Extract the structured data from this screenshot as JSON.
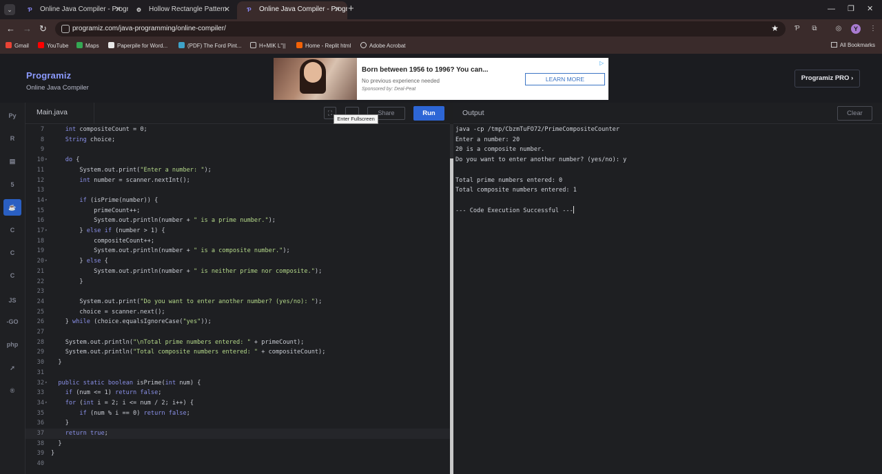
{
  "browser": {
    "tabs": [
      {
        "title": "Online Java Compiler - Program",
        "favicon": "programiz-icon",
        "active": false
      },
      {
        "title": "Hollow Rectangle Pattern",
        "favicon": "chatgpt-icon",
        "active": false
      },
      {
        "title": "Online Java Compiler - Program",
        "favicon": "programiz-icon",
        "active": true
      }
    ],
    "url": "programiz.com/java-programming/online-compiler/",
    "bookmarks": [
      {
        "label": "Gmail",
        "icon": "gmail-icon",
        "color": "#ea4335"
      },
      {
        "label": "YouTube",
        "icon": "youtube-icon",
        "color": "#ff0000"
      },
      {
        "label": "Maps",
        "icon": "maps-icon",
        "color": "#34a853"
      },
      {
        "label": "Paperpile for Word...",
        "icon": "paperpile-icon",
        "color": "#e8e8e8"
      },
      {
        "label": "(PDF) The Ford Pint...",
        "icon": "pdf-icon",
        "color": "#3ea3c9"
      },
      {
        "label": "H+MIK L\"||",
        "icon": "folder-icon",
        "color": "#cccccc"
      },
      {
        "label": "Home - Replit html",
        "icon": "replit-icon",
        "color": "#f26207"
      },
      {
        "label": "Adobe Acrobat",
        "icon": "acrobat-icon",
        "color": "#dddddd"
      }
    ],
    "all_bookmarks": "All Bookmarks",
    "profile_initial": "Y"
  },
  "site": {
    "logo": "Programiz",
    "subtitle": "Online Java Compiler",
    "pro_button": "Programiz PRO ›"
  },
  "ad": {
    "title": "Born between 1956 to 1996? You can...",
    "subtitle": "No previous experience needed",
    "sponsor": "Sponsored by: Deal-Peat",
    "button": "LEARN MORE"
  },
  "sidebar": {
    "languages": [
      {
        "name": "python-icon",
        "glyph": "Py"
      },
      {
        "name": "r-icon",
        "glyph": "R"
      },
      {
        "name": "sql-icon",
        "glyph": "▤"
      },
      {
        "name": "html-icon",
        "glyph": "5"
      },
      {
        "name": "java-icon",
        "glyph": "☕",
        "active": true
      },
      {
        "name": "c-icon",
        "glyph": "C"
      },
      {
        "name": "cpp-icon",
        "glyph": "C"
      },
      {
        "name": "csharp-icon",
        "glyph": "C"
      },
      {
        "name": "js-icon",
        "glyph": "JS"
      },
      {
        "name": "go-icon",
        "glyph": "-GO"
      },
      {
        "name": "php-icon",
        "glyph": "php"
      },
      {
        "name": "swift-icon",
        "glyph": "➚"
      },
      {
        "name": "rust-icon",
        "glyph": "®"
      }
    ]
  },
  "editor": {
    "filename": "Main.java",
    "tooltip": "Enter Fullscreen",
    "share_label": "Share",
    "run_label": "Run",
    "lines": [
      {
        "n": "7",
        "code": "    int compositeCount = 0;"
      },
      {
        "n": "8",
        "code": "    String choice;"
      },
      {
        "n": "9",
        "code": ""
      },
      {
        "n": "10",
        "code": "    do {",
        "fold": true
      },
      {
        "n": "11",
        "code": "        System.out.print(\"Enter a number: \");"
      },
      {
        "n": "12",
        "code": "        int number = scanner.nextInt();"
      },
      {
        "n": "13",
        "code": ""
      },
      {
        "n": "14",
        "code": "        if (isPrime(number)) {",
        "fold": true
      },
      {
        "n": "15",
        "code": "            primeCount++;"
      },
      {
        "n": "16",
        "code": "            System.out.println(number + \" is a prime number.\");"
      },
      {
        "n": "17",
        "code": "        } else if (number > 1) {",
        "fold": true
      },
      {
        "n": "18",
        "code": "            compositeCount++;"
      },
      {
        "n": "19",
        "code": "            System.out.println(number + \" is a composite number.\");"
      },
      {
        "n": "20",
        "code": "        } else {",
        "fold": true
      },
      {
        "n": "21",
        "code": "            System.out.println(number + \" is neither prime nor composite.\");"
      },
      {
        "n": "22",
        "code": "        }"
      },
      {
        "n": "23",
        "code": ""
      },
      {
        "n": "24",
        "code": "        System.out.print(\"Do you want to enter another number? (yes/no): \");"
      },
      {
        "n": "25",
        "code": "        choice = scanner.next();"
      },
      {
        "n": "26",
        "code": "    } while (choice.equalsIgnoreCase(\"yes\"));"
      },
      {
        "n": "27",
        "code": ""
      },
      {
        "n": "28",
        "code": "    System.out.println(\"\\nTotal prime numbers entered: \" + primeCount);"
      },
      {
        "n": "29",
        "code": "    System.out.println(\"Total composite numbers entered: \" + compositeCount);"
      },
      {
        "n": "30",
        "code": "  }"
      },
      {
        "n": "31",
        "code": ""
      },
      {
        "n": "32",
        "code": "  public static boolean isPrime(int num) {",
        "fold": true
      },
      {
        "n": "33",
        "code": "    if (num <= 1) return false;"
      },
      {
        "n": "34",
        "code": "    for (int i = 2; i <= num / 2; i++) {",
        "fold": true
      },
      {
        "n": "35",
        "code": "        if (num % i == 0) return false;"
      },
      {
        "n": "36",
        "code": "    }"
      },
      {
        "n": "37",
        "code": "    return true;",
        "active": true
      },
      {
        "n": "38",
        "code": "  }"
      },
      {
        "n": "39",
        "code": "}"
      },
      {
        "n": "40",
        "code": ""
      }
    ]
  },
  "output": {
    "title": "Output",
    "clear_label": "Clear",
    "lines": [
      "java -cp /tmp/CbzmTuFO72/PrimeCompositeCounter",
      "Enter a number: 20",
      "20 is a composite number.",
      "Do you want to enter another number? (yes/no): y",
      "",
      "Total prime numbers entered: 0",
      "Total composite numbers entered: 1",
      "",
      "--- Code Execution Successful ---"
    ]
  }
}
